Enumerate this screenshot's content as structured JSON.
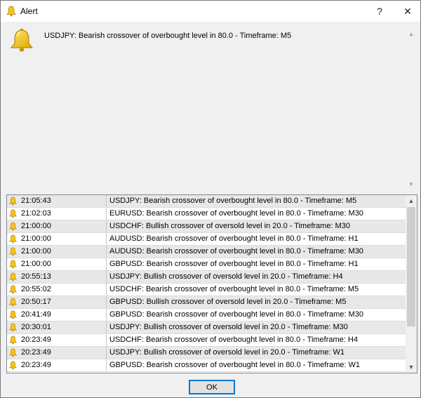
{
  "window": {
    "title": "Alert",
    "help_label": "?",
    "close_label": "✕"
  },
  "message": "USDJPY: Bearish crossover of overbought level in 80.0 - Timeframe: M5",
  "log": [
    {
      "time": "21:05:43",
      "text": "USDJPY: Bearish crossover of overbought level in 80.0 - Timeframe: M5"
    },
    {
      "time": "21:02:03",
      "text": "EURUSD: Bearish crossover of overbought level in 80.0 - Timeframe: M30"
    },
    {
      "time": "21:00:00",
      "text": "USDCHF: Bullish crossover of oversold level in 20.0 - Timeframe: M30"
    },
    {
      "time": "21:00:00",
      "text": "AUDUSD: Bearish crossover of overbought level in 80.0 - Timeframe: H1"
    },
    {
      "time": "21:00:00",
      "text": "AUDUSD: Bearish crossover of overbought level in 80.0 - Timeframe: M30"
    },
    {
      "time": "21:00:00",
      "text": "GBPUSD: Bearish crossover of overbought level in 80.0 - Timeframe: H1"
    },
    {
      "time": "20:55:13",
      "text": "USDJPY: Bullish crossover of oversold level in 20.0 - Timeframe: H4"
    },
    {
      "time": "20:55:02",
      "text": "USDCHF: Bearish crossover of overbought level in 80.0 - Timeframe: M5"
    },
    {
      "time": "20:50:17",
      "text": "GBPUSD: Bullish crossover of oversold level in 20.0 - Timeframe: M5"
    },
    {
      "time": "20:41:49",
      "text": "GBPUSD: Bearish crossover of overbought level in 80.0 - Timeframe: M30"
    },
    {
      "time": "20:30:01",
      "text": "USDJPY: Bullish crossover of oversold level in 20.0 - Timeframe: M30"
    },
    {
      "time": "20:23:49",
      "text": "USDCHF: Bearish crossover of overbought level in 80.0 - Timeframe: H4"
    },
    {
      "time": "20:23:49",
      "text": "USDJPY: Bullish crossover of oversold level in 20.0 - Timeframe: W1"
    },
    {
      "time": "20:23:49",
      "text": "GBPUSD: Bearish crossover of overbought level in 80.0 - Timeframe: W1"
    }
  ],
  "ok_label": "OK",
  "icons": {
    "bell": "bell-icon",
    "up": "chevron-up-icon",
    "down": "chevron-down-icon"
  },
  "colors": {
    "bell_fill": "#f5c518",
    "bell_outline": "#b8860b",
    "row_alt": "#e8e8e8",
    "focus_border": "#0078d7"
  }
}
